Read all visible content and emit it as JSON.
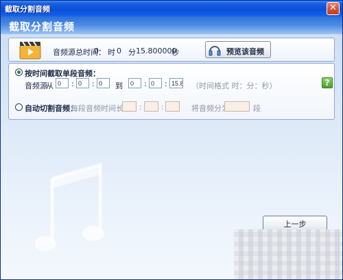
{
  "window": {
    "title": "截取分割音频",
    "close_glyph": "✕"
  },
  "header": {
    "title": "截取分割音频"
  },
  "duration": {
    "label": "音频源总时间：",
    "hours": "0",
    "hours_unit": "时",
    "minutes": "0",
    "minutes_unit": "分",
    "seconds": "15.800000",
    "seconds_unit": "秒"
  },
  "preview_button": {
    "label": "预览该音频",
    "icon": "headphones-icon"
  },
  "option_time": {
    "label": "按时间截取单段音频：",
    "selected": true,
    "source_label": "音频源",
    "from_label": "从",
    "to_label": "到",
    "from": {
      "h": "0",
      "m": "0",
      "s": "0"
    },
    "to": {
      "h": "0",
      "m": "0",
      "s": "15.8"
    },
    "sep": ":",
    "format_hint": "（时间格式 时：分：秒）",
    "help_glyph": "?"
  },
  "option_auto": {
    "label": "自动切割音频：",
    "selected": false,
    "segment_label": "每段音频时间长度",
    "segment": {
      "h": "",
      "m": "",
      "s": ""
    },
    "count_label": "将音频分为",
    "count_value": "",
    "count_unit": "段"
  },
  "footer": {
    "prev_label": "上一步"
  },
  "colors": {
    "title_bar": "#0a4fd6",
    "accent": "#2d6fd9",
    "panel_border": "#8fa9d0"
  }
}
